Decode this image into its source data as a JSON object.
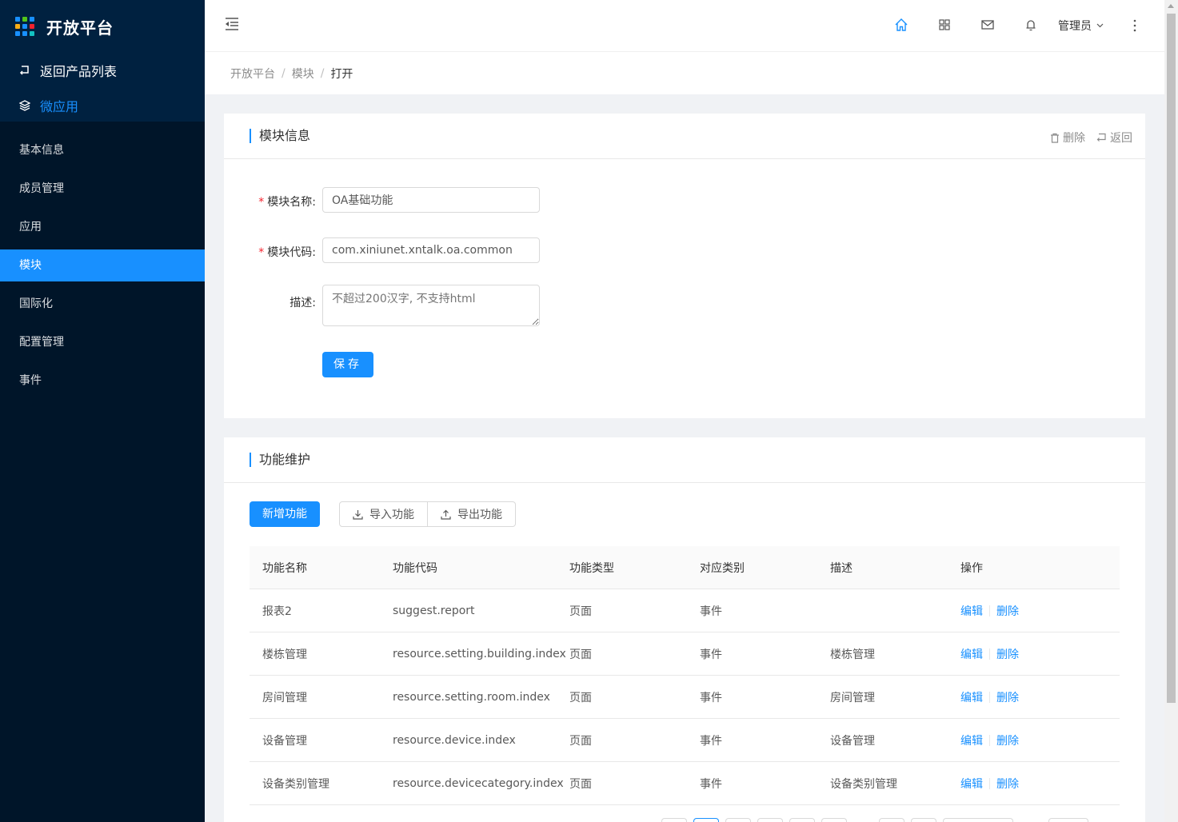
{
  "brand": {
    "title": "开放平台",
    "grid_colors": [
      "#1890ff",
      "#52c41a",
      "#1890ff",
      "#faad14",
      "#1890ff",
      "#f5222d",
      "#1890ff",
      "#1890ff",
      "#13c2c2"
    ]
  },
  "sidebar": {
    "back_label": "返回产品列表",
    "app_label": "微应用",
    "items": [
      {
        "label": "基本信息",
        "active": false
      },
      {
        "label": "成员管理",
        "active": false
      },
      {
        "label": "应用",
        "active": false
      },
      {
        "label": "模块",
        "active": true
      },
      {
        "label": "国际化",
        "active": false
      },
      {
        "label": "配置管理",
        "active": false
      },
      {
        "label": "事件",
        "active": false
      }
    ]
  },
  "header": {
    "icons": [
      "home-icon",
      "apps-icon",
      "mail-icon",
      "bell-icon"
    ],
    "user": "管理员"
  },
  "breadcrumb": [
    "开放平台",
    "模块",
    "打开"
  ],
  "module_info": {
    "title": "模块信息",
    "delete_label": "删除",
    "back_label": "返回",
    "name_label": "模块名称:",
    "name_value": "OA基础功能",
    "code_label": "模块代码:",
    "code_value": "com.xiniunet.xntalk.oa.common",
    "desc_label": "描述:",
    "desc_placeholder": "不超过200汉字, 不支持html",
    "save_label": "保存"
  },
  "functions": {
    "title": "功能维护",
    "add_label": "新增功能",
    "import_label": "导入功能",
    "export_label": "导出功能",
    "columns": [
      "功能名称",
      "功能代码",
      "功能类型",
      "对应类别",
      "描述",
      "操作"
    ],
    "rows": [
      {
        "name": "报表2",
        "code": "suggest.report",
        "type": "页面",
        "category": "事件",
        "desc": ""
      },
      {
        "name": "楼栋管理",
        "code": "resource.setting.building.index",
        "type": "页面",
        "category": "事件",
        "desc": "楼栋管理"
      },
      {
        "name": "房间管理",
        "code": "resource.setting.room.index",
        "type": "页面",
        "category": "事件",
        "desc": "房间管理"
      },
      {
        "name": "设备管理",
        "code": "resource.device.index",
        "type": "页面",
        "category": "事件",
        "desc": "设备管理"
      },
      {
        "name": "设备类别管理",
        "code": "resource.devicecategory.index",
        "type": "页面",
        "category": "事件",
        "desc": "设备类别管理"
      }
    ],
    "edit_label": "编辑",
    "delete_label": "删除"
  },
  "colors": {
    "primary": "#1890ff",
    "sidebar": "#001529",
    "sidebar_top": "#002140",
    "required": "#f5222d"
  }
}
